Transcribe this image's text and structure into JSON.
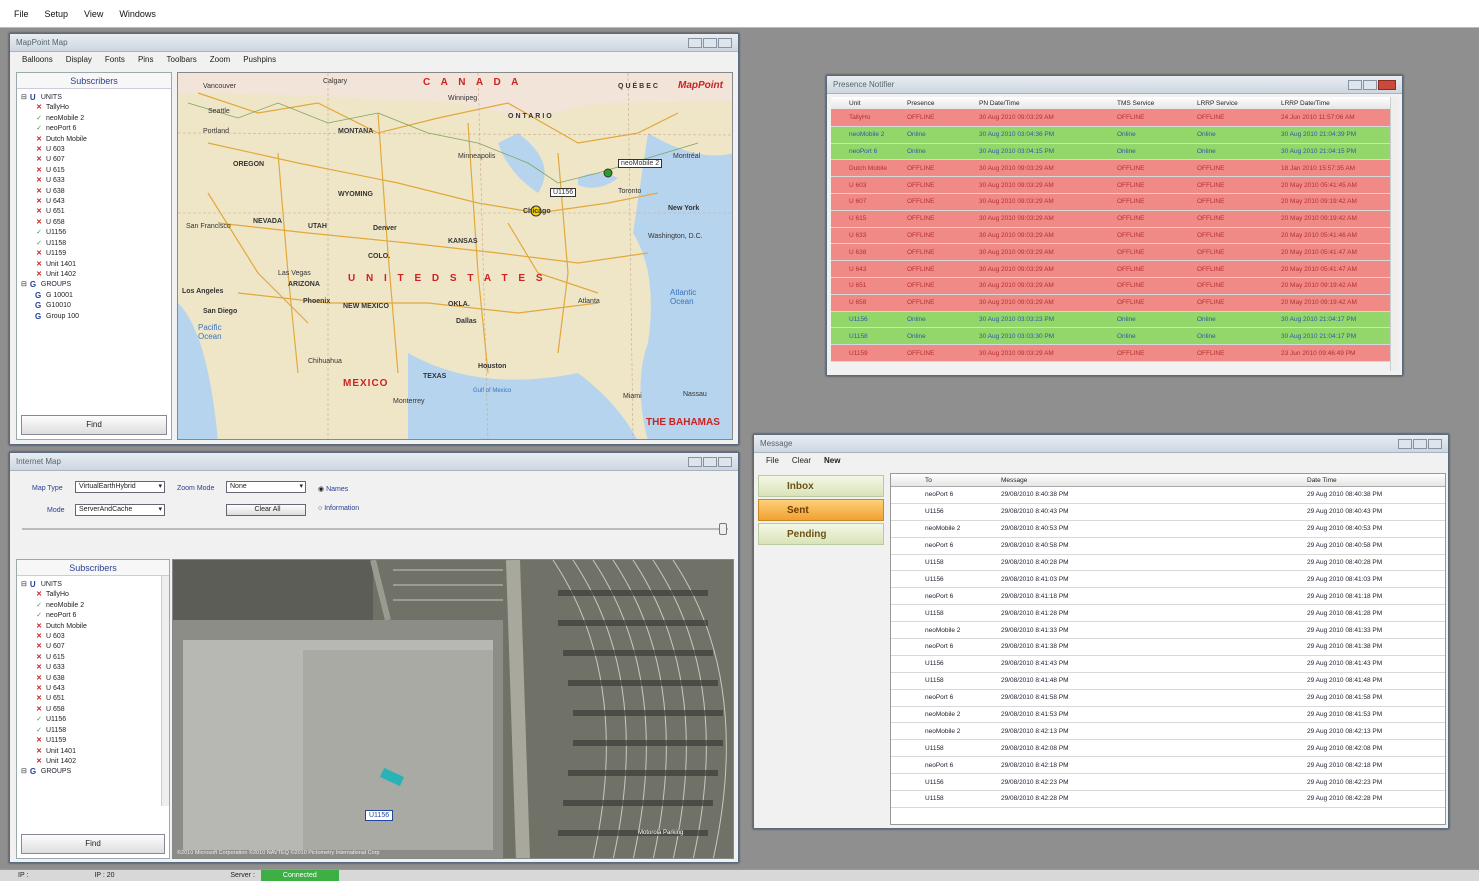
{
  "menubar": [
    "File",
    "Setup",
    "View",
    "Windows"
  ],
  "mappoint": {
    "title": "MapPoint Map",
    "menu": [
      "Balloons",
      "Display",
      "Fonts",
      "Pins",
      "Toolbars",
      "Zoom",
      "Pushpins"
    ],
    "map_labels": {
      "canada": "C A N A D A",
      "usa": "U N I T E D   S T A T E S",
      "mexico": "MEXICO",
      "bahamas": "THE BAHAMAS",
      "logo": "MapPoint",
      "pacific": "Pacific Ocean",
      "atlantic": "Atlantic Ocean",
      "gulf": "Gulf of Mexico",
      "quebec": "QUÉBEC",
      "ontario": "ONTARIO",
      "vancouver": "Vancouver",
      "seattle": "Seattle",
      "portland": "Portland",
      "oregon": "OREGON",
      "sanfrancisco": "San Francisco",
      "losangeles": "Los Angeles",
      "sandiego": "San Diego",
      "lasvegas": "Las Vegas",
      "phoenix": "Phoenix",
      "denver": "Denver",
      "dallas": "Dallas",
      "houston": "Houston",
      "chicago": "Chicago",
      "newyork": "New York",
      "washington": "Washington, D.C.",
      "montreal": "Montréal",
      "toronto": "Toronto",
      "calgary": "Calgary",
      "winnipeg": "Winnipeg",
      "montana": "MONTANA",
      "wyoming": "WYOMING",
      "nevada": "NEVADA",
      "utah": "UTAH",
      "colorado": "COLO.",
      "kansas": "KANSAS",
      "texas": "TEXAS",
      "arizona": "ARIZONA",
      "newmexico": "NEW MEXICO",
      "okla": "OKLA.",
      "minneapolis": "Minneapolis",
      "atlanta": "Atlanta",
      "miami": "Miami",
      "monterrey": "Monterrey",
      "chihuahua": "Chihuahua",
      "nassau": "Nassau",
      "pin1": "neoMobile 2",
      "pin2": "U1156"
    }
  },
  "subscribers": {
    "header": "Subscribers",
    "units_label": "UNITS",
    "groups_label": "GROUPS",
    "units": [
      {
        "name": "TallyHo",
        "status": "x"
      },
      {
        "name": "neoMobile 2",
        "status": "ok"
      },
      {
        "name": "neoPort 6",
        "status": "ok"
      },
      {
        "name": "Dutch Mobile",
        "status": "x"
      },
      {
        "name": "U 603",
        "status": "x"
      },
      {
        "name": "U 607",
        "status": "x"
      },
      {
        "name": "U 615",
        "status": "x"
      },
      {
        "name": "U 633",
        "status": "x"
      },
      {
        "name": "U 638",
        "status": "x"
      },
      {
        "name": "U 643",
        "status": "x"
      },
      {
        "name": "U 651",
        "status": "x"
      },
      {
        "name": "U 658",
        "status": "x"
      },
      {
        "name": "U1156",
        "status": "ok"
      },
      {
        "name": "U1158",
        "status": "ok"
      },
      {
        "name": "U1159",
        "status": "x"
      },
      {
        "name": "Unit 1401",
        "status": "x"
      },
      {
        "name": "Unit 1402",
        "status": "x"
      }
    ],
    "groups": [
      "G 10001",
      "G10010",
      "Group 100"
    ],
    "find_label": "Find"
  },
  "internet_map": {
    "title": "Internet Map",
    "map_type_label": "Map Type",
    "map_type_value": "VirtualEarthHybrid",
    "mode_label": "Mode",
    "mode_value": "ServerAndCache",
    "zoom_mode_label": "Zoom Mode",
    "zoom_mode_value": "None",
    "clear_all": "Clear All",
    "radio_names": "Names",
    "radio_info": "Information",
    "pin_label": "U1156",
    "copyright": "©2010 Microsoft Corporation  ©2010 NAVTEQ  ©2010 Pictometry International Corp",
    "parking": "Motorola Parking",
    "groups_cut": "GROUPS"
  },
  "presence": {
    "title": "Presence Notifier",
    "columns": [
      "Unit",
      "Presence",
      "PN Date/Time",
      "TMS Service",
      "LRRP Service",
      "LRRP Date/Time"
    ],
    "rows": [
      {
        "unit": "TallyHo",
        "presence": "OFFLINE",
        "pn": "30 Aug 2010 09:03:29 AM",
        "tms": "OFFLINE",
        "lrrp": "OFFLINE",
        "lrrp_dt": "24 Jun 2010 11:57:06 AM",
        "color": "red"
      },
      {
        "unit": "neoMobile 2",
        "presence": "Online",
        "pn": "30 Aug 2010 03:04:36 PM",
        "tms": "Online",
        "lrrp": "Online",
        "lrrp_dt": "30 Aug 2010 21:04:39 PM",
        "color": "green"
      },
      {
        "unit": "neoPort 6",
        "presence": "Online",
        "pn": "30 Aug 2010 03:04:15 PM",
        "tms": "Online",
        "lrrp": "Online",
        "lrrp_dt": "30 Aug 2010 21:04:15 PM",
        "color": "green"
      },
      {
        "unit": "Dutch Mobile",
        "presence": "OFFLINE",
        "pn": "30 Aug 2010 09:03:29 AM",
        "tms": "OFFLINE",
        "lrrp": "OFFLINE",
        "lrrp_dt": "18 Jan 2010 15:57:35 AM",
        "color": "red"
      },
      {
        "unit": "U 603",
        "presence": "OFFLINE",
        "pn": "30 Aug 2010 09:03:29 AM",
        "tms": "OFFLINE",
        "lrrp": "OFFLINE",
        "lrrp_dt": "20 May 2010 05:41:45 AM",
        "color": "red"
      },
      {
        "unit": "U 607",
        "presence": "OFFLINE",
        "pn": "30 Aug 2010 09:03:29 AM",
        "tms": "OFFLINE",
        "lrrp": "OFFLINE",
        "lrrp_dt": "20 May 2010 09:19:42 AM",
        "color": "red"
      },
      {
        "unit": "U 615",
        "presence": "OFFLINE",
        "pn": "30 Aug 2010 09:03:29 AM",
        "tms": "OFFLINE",
        "lrrp": "OFFLINE",
        "lrrp_dt": "20 May 2010 09:19:42 AM",
        "color": "red"
      },
      {
        "unit": "U 633",
        "presence": "OFFLINE",
        "pn": "30 Aug 2010 09:03:29 AM",
        "tms": "OFFLINE",
        "lrrp": "OFFLINE",
        "lrrp_dt": "20 May 2010 05:41:46 AM",
        "color": "red"
      },
      {
        "unit": "U 638",
        "presence": "OFFLINE",
        "pn": "30 Aug 2010 09:03:29 AM",
        "tms": "OFFLINE",
        "lrrp": "OFFLINE",
        "lrrp_dt": "20 May 2010 05:41:47 AM",
        "color": "red"
      },
      {
        "unit": "U 643",
        "presence": "OFFLINE",
        "pn": "30 Aug 2010 09:03:29 AM",
        "tms": "OFFLINE",
        "lrrp": "OFFLINE",
        "lrrp_dt": "20 May 2010 05:41:47 AM",
        "color": "red"
      },
      {
        "unit": "U 651",
        "presence": "OFFLINE",
        "pn": "30 Aug 2010 09:03:29 AM",
        "tms": "OFFLINE",
        "lrrp": "OFFLINE",
        "lrrp_dt": "20 May 2010 09:19:42 AM",
        "color": "red"
      },
      {
        "unit": "U 658",
        "presence": "OFFLINE",
        "pn": "30 Aug 2010 09:03:29 AM",
        "tms": "OFFLINE",
        "lrrp": "OFFLINE",
        "lrrp_dt": "20 May 2010 09:19:42 AM",
        "color": "red"
      },
      {
        "unit": "U1156",
        "presence": "Online",
        "pn": "30 Aug 2010 03:03:23 PM",
        "tms": "Online",
        "lrrp": "Online",
        "lrrp_dt": "30 Aug 2010 21:04:17 PM",
        "color": "green"
      },
      {
        "unit": "U1158",
        "presence": "Online",
        "pn": "30 Aug 2010 03:03:30 PM",
        "tms": "Online",
        "lrrp": "Online",
        "lrrp_dt": "30 Aug 2010 21:04:17 PM",
        "color": "green"
      },
      {
        "unit": "U1159",
        "presence": "OFFLINE",
        "pn": "30 Aug 2010 09:03:29 AM",
        "tms": "OFFLINE",
        "lrrp": "OFFLINE",
        "lrrp_dt": "23 Jun 2010 09:46:49 PM",
        "color": "red"
      }
    ]
  },
  "message": {
    "title": "Message",
    "menu": [
      "File",
      "Clear",
      "New"
    ],
    "folders": [
      "Inbox",
      "Sent",
      "Pending"
    ],
    "selected_folder": "Sent",
    "columns": [
      "To",
      "Message",
      "Date Time"
    ],
    "rows": [
      [
        "neoPort 6",
        "29/08/2010 8:40:38 PM",
        "29 Aug 2010 08:40:38 PM"
      ],
      [
        "U1156",
        "29/08/2010 8:40:43 PM",
        "29 Aug 2010 08:40:43 PM"
      ],
      [
        "neoMobile 2",
        "29/08/2010 8:40:53 PM",
        "29 Aug 2010 08:40:53 PM"
      ],
      [
        "neoPort 6",
        "29/08/2010 8:40:58 PM",
        "29 Aug 2010 08:40:58 PM"
      ],
      [
        "U1158",
        "29/08/2010 8:40:28 PM",
        "29 Aug 2010 08:40:28 PM"
      ],
      [
        "U1156",
        "29/08/2010 8:41:03 PM",
        "29 Aug 2010 08:41:03 PM"
      ],
      [
        "neoPort 6",
        "29/08/2010 8:41:18 PM",
        "29 Aug 2010 08:41:18 PM"
      ],
      [
        "U1158",
        "29/08/2010 8:41:28 PM",
        "29 Aug 2010 08:41:28 PM"
      ],
      [
        "neoMobile 2",
        "29/08/2010 8:41:33 PM",
        "29 Aug 2010 08:41:33 PM"
      ],
      [
        "neoPort 6",
        "29/08/2010 8:41:38 PM",
        "29 Aug 2010 08:41:38 PM"
      ],
      [
        "U1156",
        "29/08/2010 8:41:43 PM",
        "29 Aug 2010 08:41:43 PM"
      ],
      [
        "U1158",
        "29/08/2010 8:41:48 PM",
        "29 Aug 2010 08:41:48 PM"
      ],
      [
        "neoPort 6",
        "29/08/2010 8:41:58 PM",
        "29 Aug 2010 08:41:58 PM"
      ],
      [
        "neoMobile 2",
        "29/08/2010 8:41:53 PM",
        "29 Aug 2010 08:41:53 PM"
      ],
      [
        "neoMobile 2",
        "29/08/2010 8:42:13 PM",
        "29 Aug 2010 08:42:13 PM"
      ],
      [
        "U1158",
        "29/08/2010 8:42:08 PM",
        "29 Aug 2010 08:42:08 PM"
      ],
      [
        "neoPort 6",
        "29/08/2010 8:42:18 PM",
        "29 Aug 2010 08:42:18 PM"
      ],
      [
        "U1156",
        "29/08/2010 8:42:23 PM",
        "29 Aug 2010 08:42:23 PM"
      ],
      [
        "U1158",
        "29/08/2010 8:42:28 PM",
        "29 Aug 2010 08:42:28 PM"
      ]
    ]
  },
  "statusbar": {
    "ip_label": "IP :",
    "ip_value": "IP : 20",
    "server_label": "Server :",
    "server_status": "Connected"
  },
  "colors": {
    "offline_row": "#f08a86",
    "online_row": "#93d76a",
    "connected": "#3cb043",
    "sent_folder": "#f1a132"
  }
}
